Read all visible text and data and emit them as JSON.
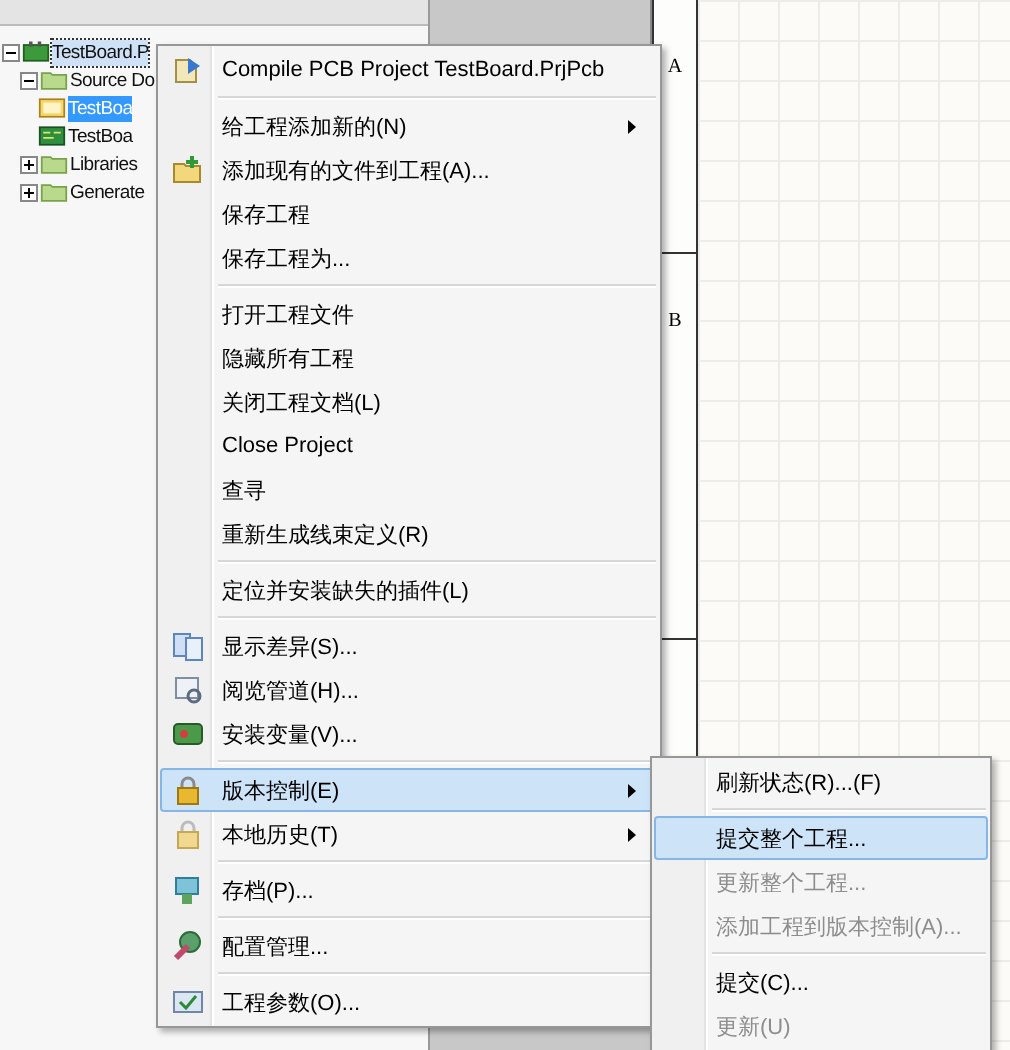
{
  "tree": [
    {
      "label": "TestBoard.P",
      "kind": "project",
      "expanded": true,
      "selected": false,
      "focused": true,
      "children": [
        {
          "label": "Source Do",
          "kind": "folder",
          "expanded": true,
          "selected": false,
          "focused": false,
          "children": [
            {
              "label": "TestBoa",
              "kind": "schematic",
              "selected": true,
              "focused": false
            },
            {
              "label": "TestBoa",
              "kind": "pcb",
              "selected": false,
              "focused": false
            }
          ]
        },
        {
          "label": "Libraries",
          "kind": "folder",
          "expanded": false,
          "selected": false,
          "focused": false
        },
        {
          "label": "Generate",
          "kind": "folder",
          "expanded": false,
          "selected": false,
          "focused": false
        }
      ]
    }
  ],
  "sheet": {
    "zones": [
      "A",
      "B"
    ]
  },
  "menu": {
    "groups": [
      [
        {
          "label": "Compile PCB Project TestBoard.PrjPcb",
          "kind": "compile",
          "has_submenu": false,
          "selected": false,
          "disabled": false
        }
      ],
      [
        {
          "label": "给工程添加新的(N)",
          "kind": "text",
          "has_submenu": true,
          "selected": false,
          "disabled": false
        },
        {
          "label": "添加现有的文件到工程(A)...",
          "kind": "add",
          "has_submenu": false,
          "selected": false,
          "disabled": false
        },
        {
          "label": "保存工程",
          "kind": "text",
          "has_submenu": false,
          "selected": false,
          "disabled": false
        },
        {
          "label": "保存工程为...",
          "kind": "text",
          "has_submenu": false,
          "selected": false,
          "disabled": false
        }
      ],
      [
        {
          "label": "打开工程文件",
          "kind": "text",
          "has_submenu": false,
          "selected": false,
          "disabled": false
        },
        {
          "label": "隐藏所有工程",
          "kind": "text",
          "has_submenu": false,
          "selected": false,
          "disabled": false
        },
        {
          "label": "关闭工程文档(L)",
          "kind": "text",
          "has_submenu": false,
          "selected": false,
          "disabled": false
        },
        {
          "label": "Close Project",
          "kind": "text",
          "has_submenu": false,
          "selected": false,
          "disabled": false
        },
        {
          "label": "查寻",
          "kind": "text",
          "has_submenu": false,
          "selected": false,
          "disabled": false
        },
        {
          "label": "重新生成线束定义(R)",
          "kind": "text",
          "has_submenu": false,
          "selected": false,
          "disabled": false
        }
      ],
      [
        {
          "label": "定位并安装缺失的插件(L)",
          "kind": "text",
          "has_submenu": false,
          "selected": false,
          "disabled": false
        }
      ],
      [
        {
          "label": "显示差异(S)...",
          "kind": "diff",
          "has_submenu": false,
          "selected": false,
          "disabled": false
        },
        {
          "label": "阅览管道(H)...",
          "kind": "browse",
          "has_submenu": false,
          "selected": false,
          "disabled": false
        },
        {
          "label": "安装变量(V)...",
          "kind": "variant",
          "has_submenu": false,
          "selected": false,
          "disabled": false
        }
      ],
      [
        {
          "label": "版本控制(E)",
          "kind": "lock",
          "has_submenu": true,
          "selected": true,
          "disabled": false
        },
        {
          "label": "本地历史(T)",
          "kind": "lock-faded",
          "has_submenu": true,
          "selected": false,
          "disabled": false
        }
      ],
      [
        {
          "label": "存档(P)...",
          "kind": "archive",
          "has_submenu": false,
          "selected": false,
          "disabled": false
        }
      ],
      [
        {
          "label": "配置管理...",
          "kind": "config",
          "has_submenu": false,
          "selected": false,
          "disabled": false
        }
      ],
      [
        {
          "label": "工程参数(O)...",
          "kind": "params",
          "has_submenu": false,
          "selected": false,
          "disabled": false
        }
      ]
    ]
  },
  "submenu": {
    "groups": [
      [
        {
          "label": "刷新状态(R)...(F)",
          "selected": false,
          "disabled": false
        }
      ],
      [
        {
          "label": "提交整个工程...",
          "selected": true,
          "disabled": false
        },
        {
          "label": "更新整个工程...",
          "selected": false,
          "disabled": true
        },
        {
          "label": "添加工程到版本控制(A)...",
          "selected": false,
          "disabled": true
        }
      ],
      [
        {
          "label": "提交(C)...",
          "selected": false,
          "disabled": false
        },
        {
          "label": "更新(U)",
          "selected": false,
          "disabled": true
        }
      ]
    ]
  }
}
